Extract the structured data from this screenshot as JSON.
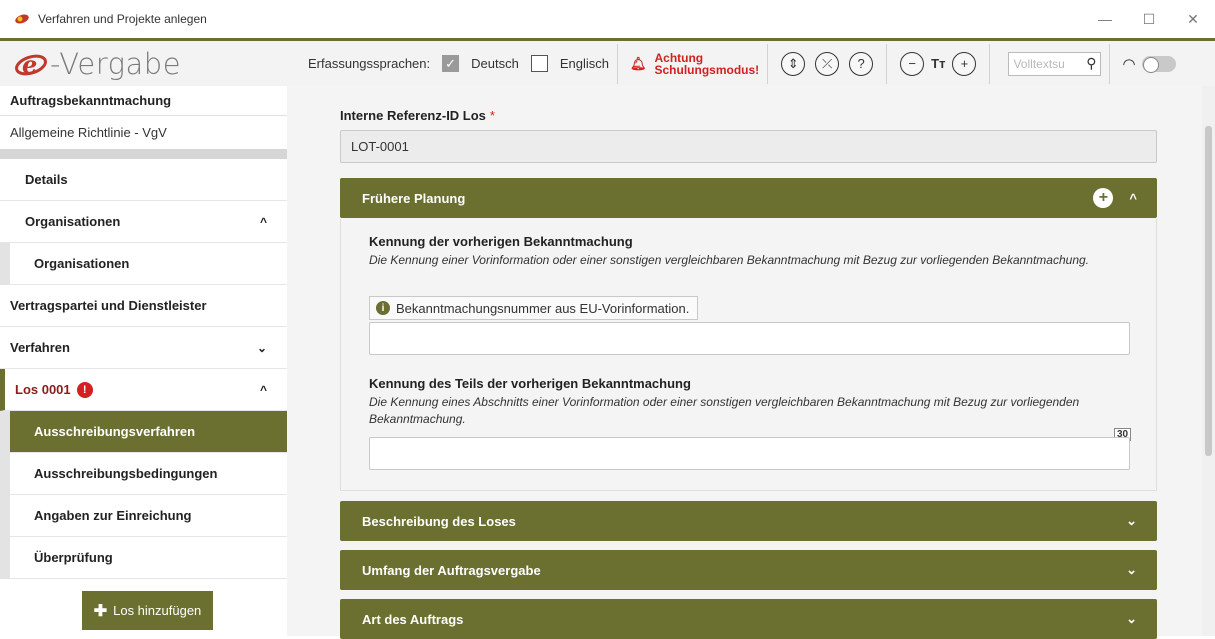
{
  "window": {
    "title": "Verfahren und Projekte anlegen",
    "minimize": "—",
    "maximize": "☐",
    "close": "✕"
  },
  "toolbar": {
    "logo_text": "-Vergabe",
    "languages_label": "Erfassungssprachen:",
    "lang_de": "Deutsch",
    "lang_en": "Englisch",
    "lang_de_checked": true,
    "lang_en_checked": false,
    "warning_line1": "Achtung",
    "warning_line2": "Schulungsmodus!",
    "search_placeholder": "Volltextsu",
    "font_size_label": "Tт",
    "accent_color": "#6b6f2f",
    "warning_color": "#d32020"
  },
  "sidebar": {
    "header": "Auftragsbekanntmachung",
    "subheader": "Allgemeine Richtlinie - VgV",
    "items": [
      {
        "label": "Details"
      },
      {
        "label": "Organisationen",
        "chevron": "^"
      },
      {
        "label": "Organisationen"
      },
      {
        "label": "Vertragspartei und Dienstleister"
      },
      {
        "label": "Verfahren",
        "chevron": "⌄"
      },
      {
        "label": "Los 0001",
        "chevron": "^",
        "error": "!"
      },
      {
        "label": "Ausschreibungsverfahren"
      },
      {
        "label": "Ausschreibungsbedingungen"
      },
      {
        "label": "Angaben zur Einreichung"
      },
      {
        "label": "Überprüfung"
      }
    ],
    "add_button": "Los hinzufügen"
  },
  "main": {
    "ref_label": "Interne Referenz-ID Los",
    "ref_required": "*",
    "ref_value": "LOT-0001",
    "panels": [
      {
        "title": "Frühere Planung",
        "add": "+",
        "chevron": "^"
      },
      {
        "title": "Beschreibung des Loses",
        "chevron": "⌄"
      },
      {
        "title": "Umfang der Auftragsvergabe",
        "chevron": "⌄"
      },
      {
        "title": "Art des Auftrags",
        "chevron": "⌄"
      }
    ],
    "section1": {
      "title": "Kennung der vorherigen Bekanntmachung",
      "description": "Die Kennung einer Vorinformation oder einer sonstigen vergleichbaren Bekanntmachung mit Bezug zur vorliegenden Bekanntmachung.",
      "hint": "Bekanntmachungsnummer aus EU-Vorinformation."
    },
    "section2": {
      "title": "Kennung des Teils der vorherigen Bekanntmachung",
      "description": "Die Kennung eines Abschnitts einer Vorinformation oder einer sonstigen vergleichbaren Bekanntmachung mit Bezug zur vorliegenden Bekanntmachung.",
      "char_counter": "30"
    }
  }
}
